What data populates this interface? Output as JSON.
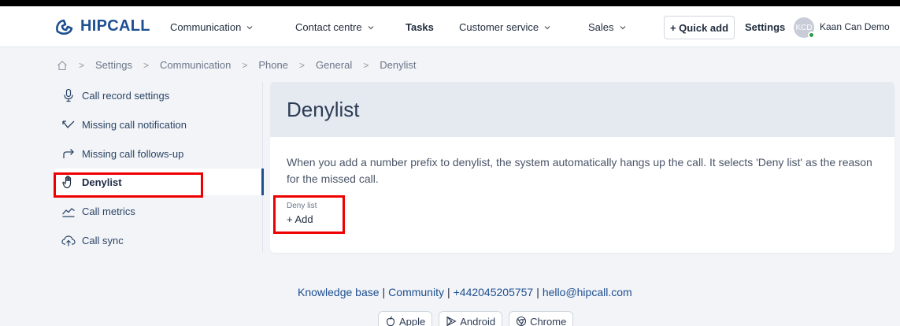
{
  "brand": {
    "name": "HIPCALL",
    "color": "#1d4f91"
  },
  "nav": {
    "items": [
      {
        "label": "Communication",
        "dropdown": true
      },
      {
        "label": "Contact centre",
        "dropdown": true
      },
      {
        "label": "Tasks",
        "dropdown": false
      },
      {
        "label": "Customer service",
        "dropdown": true
      },
      {
        "label": "Sales",
        "dropdown": true
      }
    ],
    "quick_add": "+ Quick add",
    "settings": "Settings",
    "user": {
      "initials": "KCD",
      "name": "Kaan Can Demo",
      "status_color": "#2e9a45"
    }
  },
  "breadcrumb": [
    "Settings",
    "Communication",
    "Phone",
    "General",
    "Denylist"
  ],
  "sidebar": {
    "items": [
      {
        "label": "Call record settings",
        "icon": "microphone-icon"
      },
      {
        "label": "Missing call notification",
        "icon": "missed-call-icon"
      },
      {
        "label": "Missing call follows-up",
        "icon": "forward-arrow-icon"
      },
      {
        "label": "Denylist",
        "icon": "hand-icon",
        "active": true
      },
      {
        "label": "Call metrics",
        "icon": "chart-line-icon"
      },
      {
        "label": "Call sync",
        "icon": "cloud-upload-icon"
      }
    ]
  },
  "main": {
    "title": "Denylist",
    "description": "When you add a number prefix to denylist, the system automatically hangs up the call. It selects 'Deny list' as the reason for the missed call.",
    "field_label": "Deny list",
    "add_label": "+ Add"
  },
  "footer": {
    "links": [
      "Knowledge base",
      "Community",
      "+442045205757",
      "hello@hipcall.com"
    ],
    "stores": [
      "Apple",
      "Android",
      "Chrome"
    ]
  },
  "colors": {
    "highlight": "#ee0000",
    "accent": "#1d4f91",
    "page_bg": "#f2f4f7",
    "card_head": "#e5eaf1"
  }
}
